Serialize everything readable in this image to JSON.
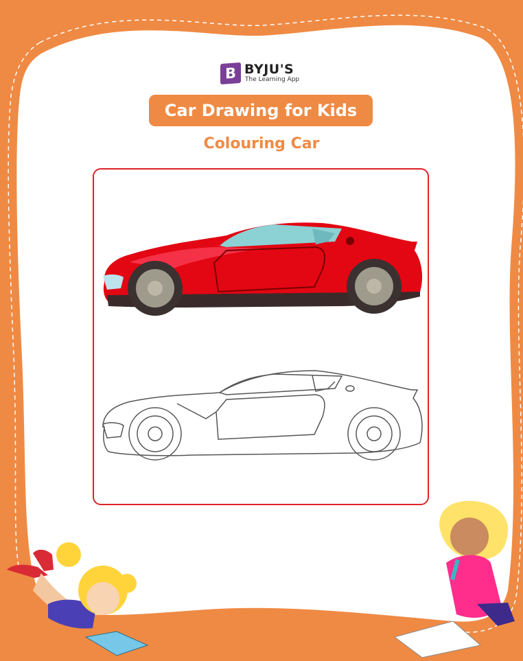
{
  "brand": {
    "badge_letter": "B",
    "name": "BYJU'S",
    "tagline": "The Learning App",
    "badge_color": "#7a3f97"
  },
  "title": "Car Drawing for Kids",
  "subtitle": "Colouring Car",
  "colors": {
    "accent": "#ef8a44",
    "frame": "#e0222a",
    "car_body": "#e30613",
    "window": "#8cd1d4"
  },
  "illustrations": {
    "colored_car": "red sports car",
    "outline_car": "sports car outline for colouring",
    "girl_reading": "girl lying down reading a book",
    "girl_drawing": "girl kneeling holding a pencil",
    "drawing_paper": "blank sheet of paper"
  }
}
